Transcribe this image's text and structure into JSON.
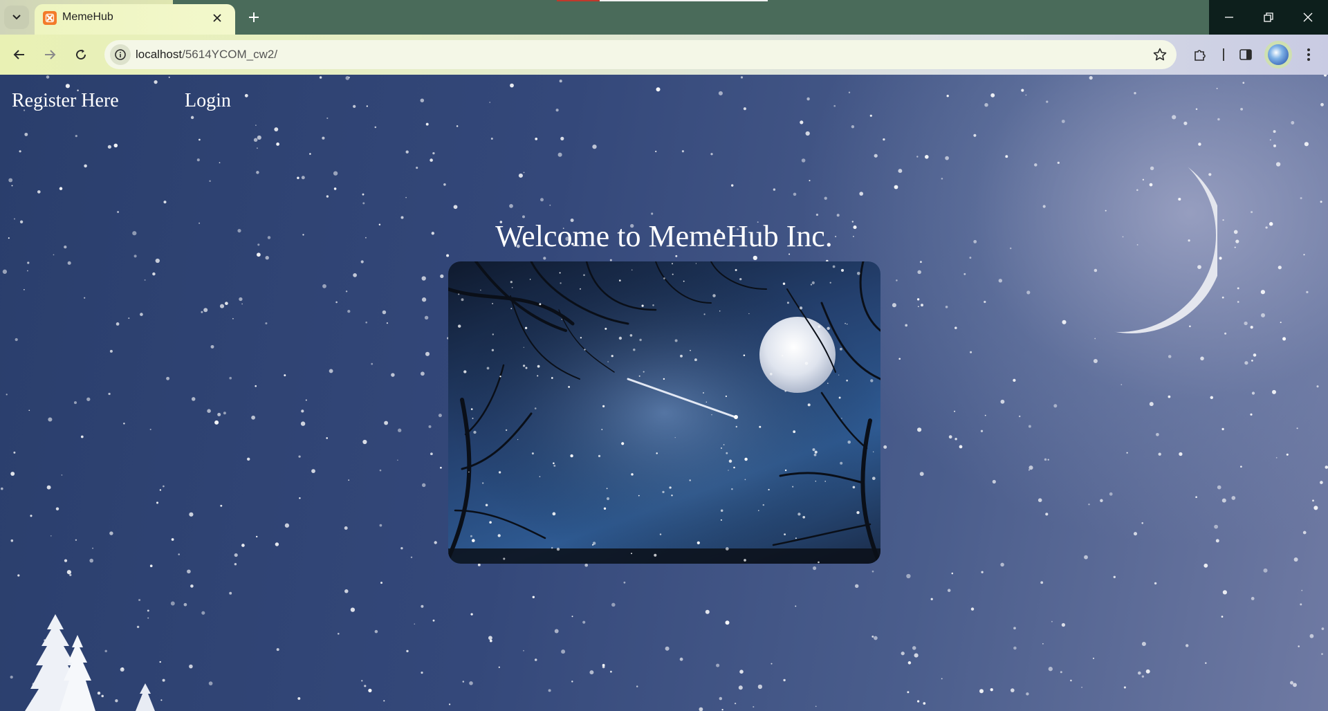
{
  "browser": {
    "tab_title": "MemeHub",
    "url_host": "localhost",
    "url_path": "/5614YCOM_cw2/",
    "icons": {
      "tab_search": "chevron-down-icon",
      "favicon": "xampp-icon",
      "tab_close": "close-icon",
      "new_tab": "plus-icon",
      "back": "arrow-left-icon",
      "forward": "arrow-right-icon",
      "reload": "reload-icon",
      "site_info": "site-info-icon",
      "bookmark": "star-icon",
      "extensions": "puzzle-icon",
      "side_panel": "side-panel-icon",
      "profile": "avatar-icon",
      "menu": "kebab-menu-icon",
      "minimize": "minimize-icon",
      "restore": "restore-icon",
      "close_window": "close-window-icon"
    }
  },
  "nav": {
    "register_label": "Register Here",
    "login_label": "Login"
  },
  "main": {
    "heading": "Welcome to MemeHub Inc."
  }
}
